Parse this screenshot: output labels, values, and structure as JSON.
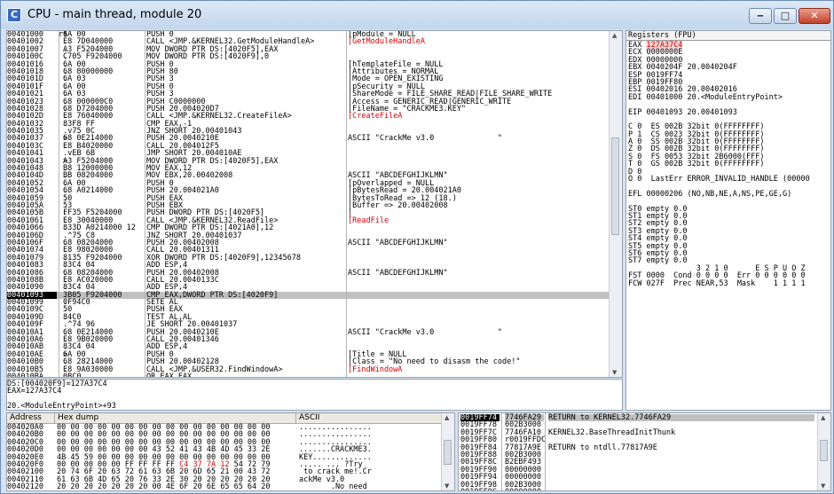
{
  "window": {
    "title": "CPU - main thread, module 20",
    "icon_letter": "C",
    "min": "‒",
    "max": "□",
    "close": "✕"
  },
  "disasm": [
    {
      "a": "00401000",
      "m": "r$",
      "h": "6A 00",
      "i": "PUSH 0",
      "c": "[pModule = NULL",
      "cc": "b"
    },
    {
      "a": "00401002",
      "m": " .",
      "h": "E8 7D040000",
      "i": "CALL <JMP.&KERNEL32.GetModuleHandleA>",
      "c": "[GetModuleHandleA",
      "cc": "r"
    },
    {
      "a": "00401007",
      "m": " .",
      "h": "A3 F5204000",
      "i": "MOV DWORD PTR DS:[4020F5],EAX",
      "c": "",
      "cc": ""
    },
    {
      "a": "0040100C",
      "m": " .",
      "h": "C705 F9204000",
      "i": "MOV DWORD PTR DS:[4020F9],0",
      "c": "",
      "cc": ""
    },
    {
      "a": "00401016",
      "m": " .",
      "h": "6A 00",
      "i": "PUSH 0",
      "c": "[hTemplateFile = NULL",
      "cc": "b"
    },
    {
      "a": "00401018",
      "m": " .",
      "h": "68 80000000",
      "i": "PUSH 80",
      "c": "|Attributes = NORMAL",
      "cc": "b"
    },
    {
      "a": "0040101D",
      "m": " .",
      "h": "6A 03",
      "i": "PUSH 3",
      "c": "|Mode = OPEN_EXISTING",
      "cc": "b"
    },
    {
      "a": "0040101F",
      "m": " .",
      "h": "6A 00",
      "i": "PUSH 0",
      "c": "|pSecurity = NULL",
      "cc": "b"
    },
    {
      "a": "00401021",
      "m": " .",
      "h": "6A 03",
      "i": "PUSH 3",
      "c": "|ShareMode = FILE_SHARE_READ|FILE_SHARE_WRITE",
      "cc": "b"
    },
    {
      "a": "00401023",
      "m": " .",
      "h": "68 000000C0",
      "i": "PUSH C0000000",
      "c": "|Access = GENERIC_READ|GENERIC_WRITE",
      "cc": "b"
    },
    {
      "a": "00401028",
      "m": " .",
      "h": "68 D7204000",
      "i": "PUSH 20.004020D7",
      "c": "|FileName = \"CRACKME3.KEY\"",
      "cc": "b"
    },
    {
      "a": "0040102D",
      "m": " .",
      "h": "E8 76040000",
      "i": "CALL <JMP.&KERNEL32.CreateFileA>",
      "c": "[CreateFileA",
      "cc": "r"
    },
    {
      "a": "00401032",
      "m": " .",
      "h": "83F8 FF",
      "i": "CMP EAX,-1",
      "c": "",
      "cc": ""
    },
    {
      "a": "00401035",
      "m": " .v75 0C",
      "h": "",
      "i": "JNZ SHORT 20.00401043",
      "c": "",
      "cc": ""
    },
    {
      "a": "00401037",
      "m": " >",
      "h": "68 0E214000",
      "i": "PUSH 20.0040210E",
      "c": "ASCII \"CrackMe v3.0              \"",
      "cc": ""
    },
    {
      "a": "0040103C",
      "m": " .",
      "h": "E8 B4020000",
      "i": "CALL 20.004012F5",
      "c": "",
      "cc": ""
    },
    {
      "a": "00401041",
      "m": " .vEB 6B",
      "h": "",
      "i": "JMP SHORT 20.004010AE",
      "c": "",
      "cc": ""
    },
    {
      "a": "00401043",
      "m": " >",
      "h": "A3 F5204000",
      "i": "MOV DWORD PTR DS:[4020F5],EAX",
      "c": "",
      "cc": ""
    },
    {
      "a": "00401048",
      "m": " .",
      "h": "B8 12000000",
      "i": "MOV EAX,12",
      "c": "",
      "cc": ""
    },
    {
      "a": "0040104D",
      "m": " .",
      "h": "BB 08204000",
      "i": "MOV EBX,20.00402008",
      "c": "ASCII \"ABCDEFGHIJKLMN\"",
      "cc": ""
    },
    {
      "a": "00401052",
      "m": " .",
      "h": "6A 00",
      "i": "PUSH 0",
      "c": "[pOverlapped = NULL",
      "cc": "b"
    },
    {
      "a": "00401054",
      "m": " .",
      "h": "68 A0214000",
      "i": "PUSH 20.004021A0",
      "c": "|pBytesRead = 20.004021A0",
      "cc": "b"
    },
    {
      "a": "00401059",
      "m": " .",
      "h": "50",
      "i": "PUSH EAX",
      "c": "|BytesToRead => 12 (18.)",
      "cc": "b"
    },
    {
      "a": "0040105A",
      "m": " .",
      "h": "53",
      "i": "PUSH EBX",
      "c": "|Buffer => 20.00402008",
      "cc": "b"
    },
    {
      "a": "0040105B",
      "m": " .",
      "h": "FF35 F5204000",
      "i": "PUSH DWORD PTR DS:[4020F5]",
      "c": "|",
      "cc": "b"
    },
    {
      "a": "00401061",
      "m": " .",
      "h": "E8 30040000",
      "i": "CALL <JMP.&KERNEL32.ReadFile>",
      "c": "[ReadFile",
      "cc": "r"
    },
    {
      "a": "00401066",
      "m": " .",
      "h": "833D A0214000 12",
      "i": "CMP DWORD PTR DS:[4021A0],12",
      "c": "",
      "cc": ""
    },
    {
      "a": "0040106D",
      "m": " .^75 C8",
      "h": "",
      "i": "JNZ SHORT 20.00401037",
      "c": "",
      "cc": ""
    },
    {
      "a": "0040106F",
      "m": " .",
      "h": "68 08204000",
      "i": "PUSH 20.00402008",
      "c": "ASCII \"ABCDEFGHIJKLMN\"",
      "cc": ""
    },
    {
      "a": "00401074",
      "m": " .",
      "h": "E8 98020000",
      "i": "CALL 20.00401311",
      "c": "",
      "cc": ""
    },
    {
      "a": "00401079",
      "m": " .",
      "h": "8135 F9204000",
      "i": "XOR DWORD PTR DS:[4020F9],12345678",
      "c": "",
      "cc": ""
    },
    {
      "a": "00401083",
      "m": " .",
      "h": "83C4 04",
      "i": "ADD ESP,4",
      "c": "",
      "cc": ""
    },
    {
      "a": "00401086",
      "m": " .",
      "h": "68 08204000",
      "i": "PUSH 20.00402008",
      "c": "ASCII \"ABCDEFGHIJKLMN\"",
      "cc": ""
    },
    {
      "a": "0040108B",
      "m": " .",
      "h": "E8 AC020000",
      "i": "CALL 20.0040133C",
      "c": "",
      "cc": ""
    },
    {
      "a": "00401090",
      "m": " .",
      "h": "83C4 04",
      "i": "ADD ESP,4",
      "c": "",
      "cc": ""
    },
    {
      "a": "00401093",
      "m": " .",
      "h": "3B05 F9204000",
      "i": "CMP EAX,DWORD PTR DS:[4020F9]",
      "c": "",
      "cc": "",
      "sel": true
    },
    {
      "a": "00401099",
      "m": " .",
      "h": "0F94C0",
      "i": "SETE AL",
      "c": "",
      "cc": ""
    },
    {
      "a": "0040109C",
      "m": " .",
      "h": "50",
      "i": "PUSH EAX",
      "c": "",
      "cc": ""
    },
    {
      "a": "0040109D",
      "m": " .",
      "h": "84C0",
      "i": "TEST AL,AL",
      "c": "",
      "cc": ""
    },
    {
      "a": "0040109F",
      "m": " .^74 96",
      "h": "",
      "i": "JE SHORT 20.00401037",
      "c": "",
      "cc": ""
    },
    {
      "a": "004010A1",
      "m": " .",
      "h": "68 0E214000",
      "i": "PUSH 20.0040210E",
      "c": "ASCII \"CrackMe v3.0              \"",
      "cc": ""
    },
    {
      "a": "004010A6",
      "m": " .",
      "h": "E8 9B020000",
      "i": "CALL 20.00401346",
      "c": "",
      "cc": ""
    },
    {
      "a": "004010AB",
      "m": " .",
      "h": "83C4 04",
      "i": "ADD ESP,4",
      "c": "",
      "cc": ""
    },
    {
      "a": "004010AE",
      "m": " >",
      "h": "6A 00",
      "i": "PUSH 0",
      "c": "[Title = NULL",
      "cc": "b"
    },
    {
      "a": "004010B0",
      "m": " .",
      "h": "68 28214000",
      "i": "PUSH 20.00402128",
      "c": "|Class = \"No need to disasm the code!\"",
      "cc": "b"
    },
    {
      "a": "004010B5",
      "m": " .",
      "h": "E8 9A030000",
      "i": "CALL <JMP.&USER32.FindWindowA>",
      "c": "[FindWindowA",
      "cc": "r"
    },
    {
      "a": "004010BA",
      "m": " .",
      "h": "0BC0",
      "i": "OR EAX,EAX",
      "c": "",
      "cc": ""
    }
  ],
  "info": [
    "DS:[004020F9]=127A37C4",
    "EAX=127A37C4",
    "",
    "20.<ModuleEntryPoint>+93"
  ],
  "registers": {
    "header": "Registers (FPU)",
    "lines": [
      {
        "t": "EAX ",
        "v": "127A37C4",
        "red": true
      },
      {
        "t": "ECX 0000000E"
      },
      {
        "t": "EDX 00000000"
      },
      {
        "t": "EBX 0040204F 20.0040204F"
      },
      {
        "t": "ESP 0019FF74"
      },
      {
        "t": "EBP 0019FF80"
      },
      {
        "t": "ESI 00402016 20.00402016"
      },
      {
        "t": "EDI 00401000 20.<ModuleEntryPoint>"
      },
      {
        "t": ""
      },
      {
        "t": "EIP 00401093 20.00401093"
      },
      {
        "t": ""
      },
      {
        "t": "C 0  ES 002B 32bit 0(FFFFFFFF)"
      },
      {
        "t": "P 1  CS 0023 32bit 0(FFFFFFFF)"
      },
      {
        "t": "A 0  SS 002B 32bit 0(FFFFFFFF)"
      },
      {
        "t": "Z 0  DS 002B 32bit 0(FFFFFFFF)"
      },
      {
        "t": "S 0  FS 0053 32bit 2B6000(FFF)"
      },
      {
        "t": "T 0  GS 002B 32bit 0(FFFFFFFF)"
      },
      {
        "t": "D 0"
      },
      {
        "t": "O 0  LastErr ERROR_INVALID_HANDLE (00000"
      },
      {
        "t": ""
      },
      {
        "t": "EFL 00000206 (NO,NB,NE,A,NS,PE,GE,G)"
      },
      {
        "t": ""
      },
      {
        "t": "ST0 empty 0.0"
      },
      {
        "t": "ST1 empty 0.0"
      },
      {
        "t": "ST2 empty 0.0"
      },
      {
        "t": "ST3 empty 0.0"
      },
      {
        "t": "ST4 empty 0.0"
      },
      {
        "t": "ST5 empty 0.0"
      },
      {
        "t": "ST6 empty 0.0"
      },
      {
        "t": "ST7 empty 0.0"
      },
      {
        "t": "               3 2 1 0      E S P U O Z"
      },
      {
        "t": "FST 0000  Cond 0 0 0 0  Err 0 0 0 0 0 0"
      },
      {
        "t": "FCW 027F  Prec NEAR,53  Mask    1 1 1 1"
      }
    ]
  },
  "dump": {
    "headers": [
      "Address",
      "Hex dump",
      "ASCII"
    ],
    "rows": [
      {
        "a": "004020A0",
        "h": "00 00 00 00 00 00 00 00 00 00 00 00 00 00 00 00",
        "s": "................"
      },
      {
        "a": "004020B0",
        "h": "00 00 00 00 00 00 00 00 00 00 00 00 00 00 00 00",
        "s": "................"
      },
      {
        "a": "004020C0",
        "h": "00 00 00 00 00 00 00 00 00 00 00 00 00 00 00 00",
        "s": "................"
      },
      {
        "a": "004020D0",
        "h": "00 00 00 00 00 00 00 43 52 41 43 4B 4D 45 33 2E",
        "s": ".......CRACKME3."
      },
      {
        "a": "004020E0",
        "h": "4B 45 59 00 00 00 00 00 00 00 00 00 00 00 00 00",
        "s": "KEY............."
      },
      {
        "a": "004020F0",
        "h": "00 00 00 00 00 FF FF FF FF ",
        "hr": "C4 37 7A 12",
        "ht": " 54 72 79",
        "s": "..... ... ?Try"
      },
      {
        "a": "00402100",
        "h": "20 74 6F 20 63 72 61 63 6B 20 6D 65 21 00 43 72",
        "s": " to crack me!.Cr"
      },
      {
        "a": "00402110",
        "h": "61 63 6B 4D 65 20 76 33 2E 30 20 20 20 20 20 20",
        "s": "ackMe v3.0      "
      },
      {
        "a": "00402120",
        "h": "20 20 20 20 20 20 20 00 4E 6F 20 6E 65 65 64 20",
        "s": "       .No need "
      }
    ]
  },
  "stack": [
    {
      "a": "0019FF74",
      "v": "7746FA29",
      "c": "RETURN to KERNEL32.7746FA29",
      "sel": true
    },
    {
      "a": "0019FF78",
      "v": "002B3000",
      "c": ""
    },
    {
      "a": "0019FF7C",
      "v": "7746FA10",
      "c": "KERNEL32.BaseThreadInitThunk"
    },
    {
      "a": "0019FF80",
      "v": "r0019FFDC",
      "c": ""
    },
    {
      "a": "0019FF84",
      "v": "77817A9E",
      "c": "RETURN to ntdll.77817A9E"
    },
    {
      "a": "0019FF88",
      "v": "002B3000",
      "c": ""
    },
    {
      "a": "0019FF8C",
      "v": "B2EBF493",
      "c": ""
    },
    {
      "a": "0019FF90",
      "v": "00000000",
      "c": ""
    },
    {
      "a": "0019FF94",
      "v": "00000000",
      "c": ""
    },
    {
      "a": "0019FF98",
      "v": "002B3000",
      "c": ""
    },
    {
      "a": "0019FF9C",
      "v": "00000000",
      "c": ""
    }
  ],
  "colors": {
    "red": "#d40000",
    "blue": "#0000c8",
    "selection": "#c0c0c0",
    "title_bg": "#c3d6ec"
  }
}
